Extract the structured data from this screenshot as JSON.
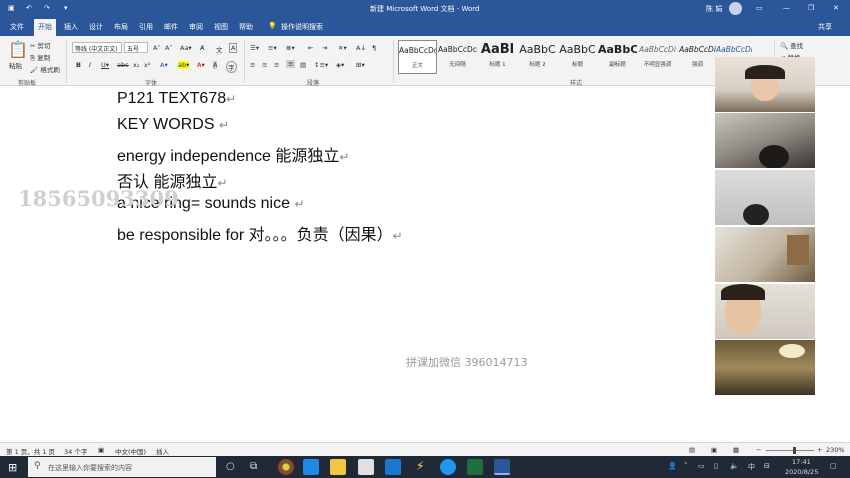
{
  "titlebar": {
    "document_title": "新建 Microsoft Word 文档 - Word",
    "user": "陈 娟",
    "quick_access": [
      "save",
      "undo",
      "redo"
    ]
  },
  "tabs": [
    "文件",
    "开始",
    "插入",
    "设计",
    "布局",
    "引用",
    "邮件",
    "审阅",
    "视图",
    "帮助"
  ],
  "active_tab": "开始",
  "tell_me": "操作说明搜索",
  "share": "共享",
  "ribbon": {
    "clipboard": {
      "paste": "粘贴",
      "cut": "剪切",
      "copy": "复制",
      "format_painter": "格式刷",
      "group": "剪贴板"
    },
    "font": {
      "font_name": "等线 (中文正文)",
      "font_size": "五号",
      "group": "字体"
    },
    "paragraph": {
      "group": "段落"
    },
    "styles": {
      "group": "样式",
      "items": [
        {
          "preview": "AaBbCcDc",
          "name": "正文"
        },
        {
          "preview": "AaBbCcDc",
          "name": "无间隔"
        },
        {
          "preview": "AaBl",
          "name": "标题 1"
        },
        {
          "preview": "AaBbC",
          "name": "标题 2"
        },
        {
          "preview": "AaBbC",
          "name": "标题"
        },
        {
          "preview": "AaBbC",
          "name": "副标题"
        },
        {
          "preview": "AaBbCcDi",
          "name": "不明显强调"
        },
        {
          "preview": "AaBbCcDi",
          "name": "强调"
        },
        {
          "preview": "AaBbCcDi",
          "name": ""
        }
      ]
    },
    "editing": {
      "find": "查找",
      "replace": "替换"
    }
  },
  "document": {
    "lines": [
      "P121    TEXT678",
      "KEY WORDS ",
      "energy independence  能源独立",
      "否认  能源独立",
      "a nice ring= sounds nice ",
      "be responsible for  对。。。负责（因果）"
    ],
    "paragraph_mark": "↵",
    "watermark": "18565093309",
    "overlay_text": "拼课加微信 396014713"
  },
  "statusbar": {
    "page": "第 1 页，共 1 页",
    "words": "34 个字",
    "language": "中文(中国)",
    "mode": "插入",
    "zoom": "230%"
  },
  "taskbar": {
    "search_placeholder": "在这里输入你要搜索的内容",
    "time": "17:41",
    "date": "2020/8/25",
    "ime": "中"
  },
  "colors": {
    "word_blue": "#2b579a",
    "taskbar": "#1f2a36"
  }
}
